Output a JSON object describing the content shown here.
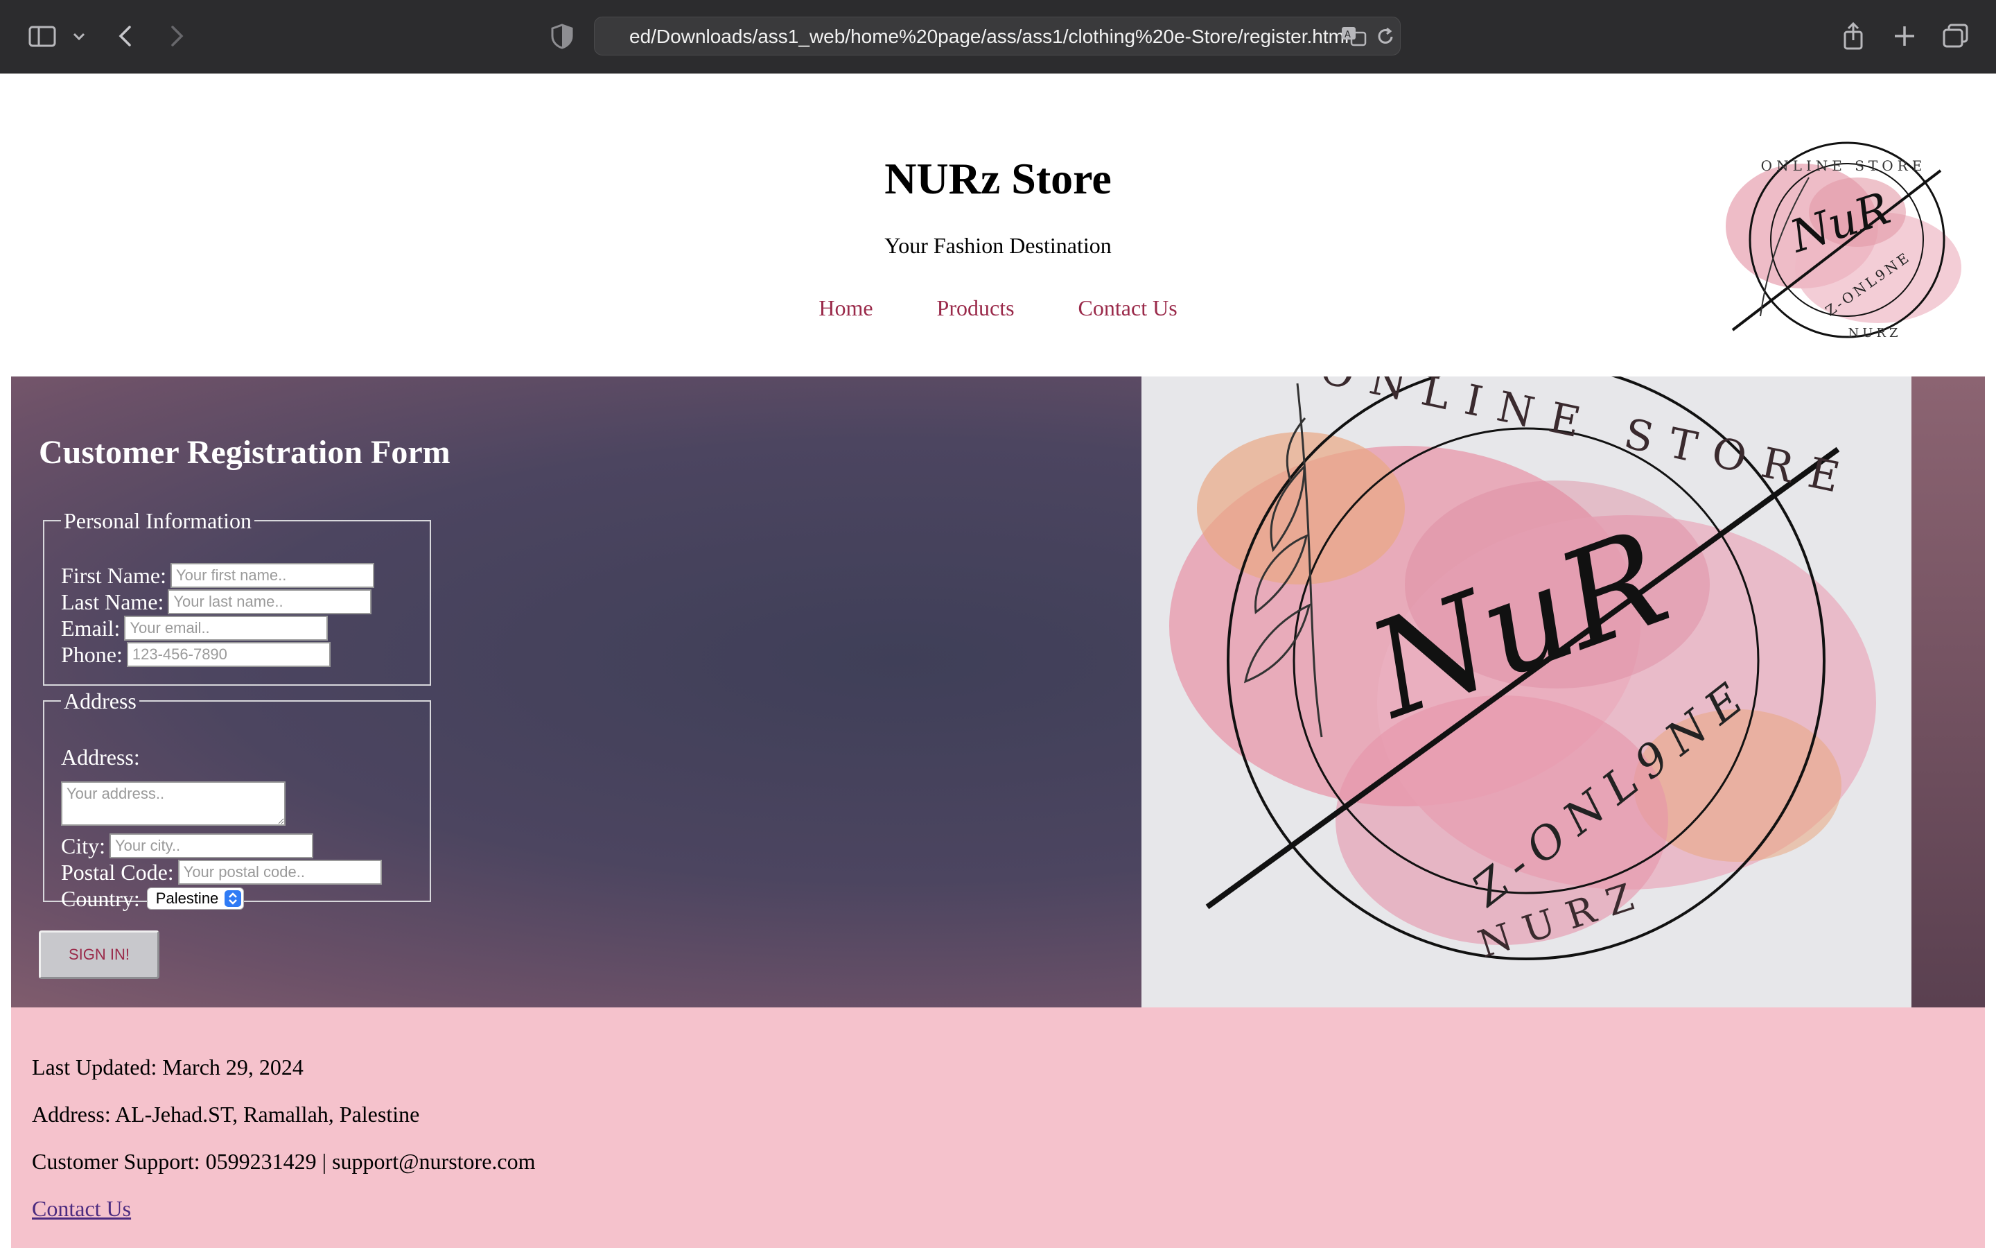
{
  "browser": {
    "url": "ed/Downloads/ass1_web/home%20page/ass/ass1/clothing%20e-Store/register.html"
  },
  "header": {
    "title": "NURz Store",
    "tagline": "Your Fashion Destination",
    "nav": [
      "Home",
      "Products",
      "Contact Us"
    ]
  },
  "logo": {
    "ring_top": "ONLINE STORE",
    "monogram": "NuR",
    "slogan": "Z-ONL9NE",
    "ring_bottom": "NURZ"
  },
  "form": {
    "title": "Customer Registration Form",
    "personal": {
      "legend": "Personal Information",
      "first_name_label": "First Name:",
      "first_name_placeholder": "Your first name..",
      "last_name_label": "Last Name:",
      "last_name_placeholder": "Your last name..",
      "email_label": "Email:",
      "email_placeholder": "Your email..",
      "phone_label": "Phone:",
      "phone_placeholder": "123-456-7890"
    },
    "address": {
      "legend": "Address",
      "address_label": "Address:",
      "address_placeholder": "Your address..",
      "city_label": "City:",
      "city_placeholder": "Your city..",
      "postal_label": "Postal Code:",
      "postal_placeholder": "Your postal code..",
      "country_label": "Country:",
      "country_value": "Palestine"
    },
    "submit_label": "SIGN IN!"
  },
  "footer": {
    "updated": "Last Updated: March 29, 2024",
    "address": "Address: AL-Jehad.ST, Ramallah, Palestine",
    "support": "Customer Support: 0599231429 | support@nurstore.com",
    "contact_link": "Contact Us"
  },
  "colors": {
    "chrome": "#2c2c2e",
    "nav_link": "#9a2a4a",
    "footer_bg": "#f5c2cc",
    "hero_bg": "#4c4560"
  }
}
